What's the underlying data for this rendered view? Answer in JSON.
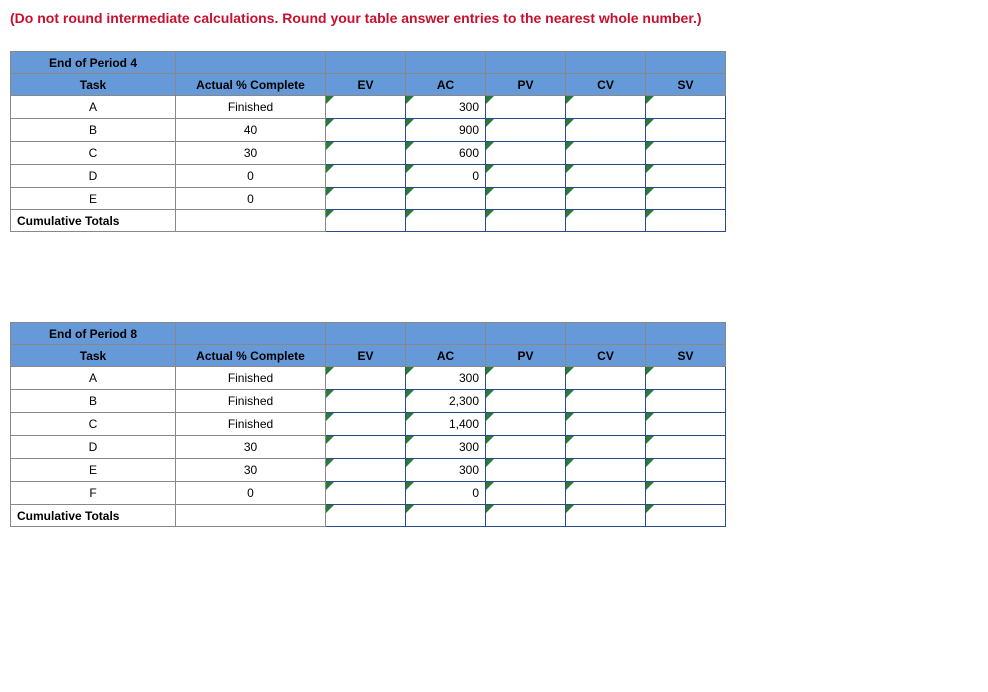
{
  "instruction": "(Do not round intermediate calculations. Round your table answer entries to the nearest whole number.)",
  "period4": {
    "title": "End of Period 4",
    "headers": {
      "task": "Task",
      "pct": "Actual % Complete",
      "ev": "EV",
      "ac": "AC",
      "pv": "PV",
      "cv": "CV",
      "sv": "SV"
    },
    "rows": [
      {
        "task": "A",
        "pct": "Finished",
        "ev": "",
        "ac": "300",
        "pv": "",
        "cv": "",
        "sv": ""
      },
      {
        "task": "B",
        "pct": "40",
        "ev": "",
        "ac": "900",
        "pv": "",
        "cv": "",
        "sv": ""
      },
      {
        "task": "C",
        "pct": "30",
        "ev": "",
        "ac": "600",
        "pv": "",
        "cv": "",
        "sv": ""
      },
      {
        "task": "D",
        "pct": "0",
        "ev": "",
        "ac": "0",
        "pv": "",
        "cv": "",
        "sv": ""
      },
      {
        "task": "E",
        "pct": "0",
        "ev": "",
        "ac": "",
        "pv": "",
        "cv": "",
        "sv": ""
      }
    ],
    "totals_label": "Cumulative Totals",
    "totals": {
      "ev": "",
      "ac": "",
      "pv": "",
      "cv": "",
      "sv": ""
    }
  },
  "period8": {
    "title": "End of Period 8",
    "headers": {
      "task": "Task",
      "pct": "Actual % Complete",
      "ev": "EV",
      "ac": "AC",
      "pv": "PV",
      "cv": "CV",
      "sv": "SV"
    },
    "rows": [
      {
        "task": "A",
        "pct": "Finished",
        "ev": "",
        "ac": "300",
        "pv": "",
        "cv": "",
        "sv": ""
      },
      {
        "task": "B",
        "pct": "Finished",
        "ev": "",
        "ac": "2,300",
        "pv": "",
        "cv": "",
        "sv": ""
      },
      {
        "task": "C",
        "pct": "Finished",
        "ev": "",
        "ac": "1,400",
        "pv": "",
        "cv": "",
        "sv": ""
      },
      {
        "task": "D",
        "pct": "30",
        "ev": "",
        "ac": "300",
        "pv": "",
        "cv": "",
        "sv": ""
      },
      {
        "task": "E",
        "pct": "30",
        "ev": "",
        "ac": "300",
        "pv": "",
        "cv": "",
        "sv": ""
      },
      {
        "task": "F",
        "pct": "0",
        "ev": "",
        "ac": "0",
        "pv": "",
        "cv": "",
        "sv": ""
      }
    ],
    "totals_label": "Cumulative Totals",
    "totals": {
      "ev": "",
      "ac": "",
      "pv": "",
      "cv": "",
      "sv": ""
    }
  }
}
